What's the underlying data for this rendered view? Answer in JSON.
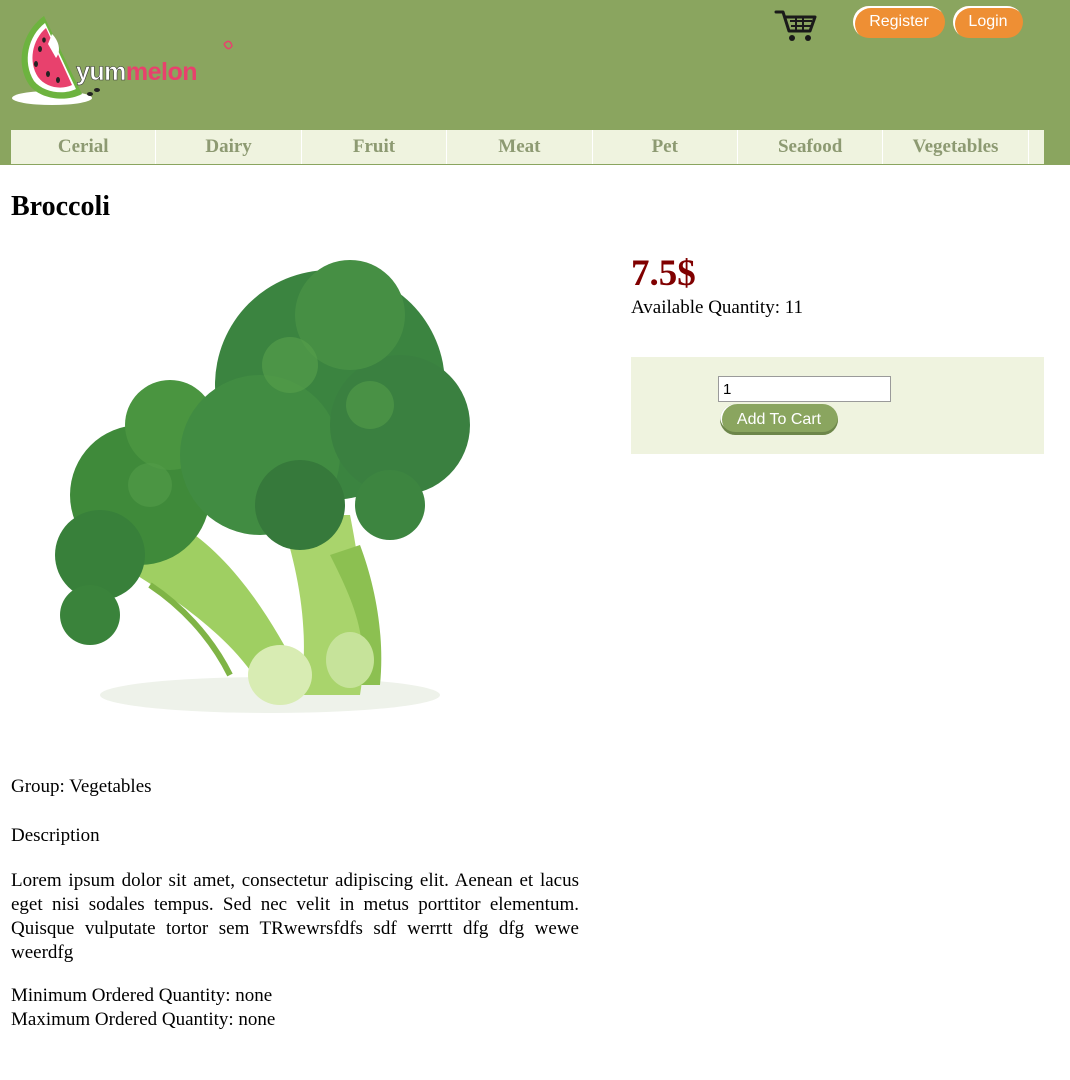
{
  "header": {
    "logo": {
      "text_part1": "yum",
      "text_part2": "melon",
      "icon": "watermelon-logo-icon"
    },
    "cart_icon": "shopping-cart-icon",
    "register_label": "Register",
    "login_label": "Login"
  },
  "nav": {
    "items": [
      {
        "label": "Cerial"
      },
      {
        "label": "Dairy"
      },
      {
        "label": "Fruit"
      },
      {
        "label": "Meat"
      },
      {
        "label": "Pet"
      },
      {
        "label": "Seafood"
      },
      {
        "label": "Vegetables"
      }
    ]
  },
  "product": {
    "title": "Broccoli",
    "image": "broccoli-image",
    "price": "7.5$",
    "available": "Available Quantity: 11",
    "quantity_value": "1",
    "add_to_cart_label": "Add To Cart",
    "group": "Group: Vegetables",
    "description_label": "Description",
    "description": "Lorem ipsum dolor sit amet, consectetur adipiscing elit. Aenean et lacus eget nisi sodales tempus. Sed nec velit in metus porttitor elementum. Quisque vulputate tortor sem TRwewrsfdfs sdf werrtt dfg dfg wewe weerdfg",
    "min_ordered": "Minimum Ordered Quantity: none",
    "max_ordered": "Maximum Ordered Quantity: none"
  },
  "colors": {
    "header_bg": "#8aa55f",
    "nav_bg": "#eff3df",
    "nav_text": "#8d9a72",
    "button_orange": "#ee8f34",
    "price_color": "#800000",
    "brand_pink": "#e8416d"
  }
}
